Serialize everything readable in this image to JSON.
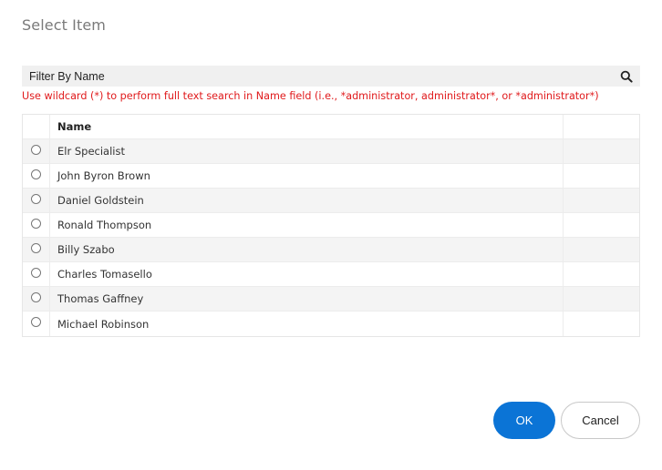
{
  "dialog": {
    "title": "Select Item"
  },
  "filter": {
    "placeholder": "Filter By Name",
    "value": "",
    "icon": "search-icon"
  },
  "hint": "Use wildcard (*) to perform full text search in Name field (i.e., *administrator, administrator*, or *administrator*)",
  "table": {
    "columns": [
      "",
      "Name",
      ""
    ],
    "rows": [
      {
        "name": "Elr Specialist",
        "selected": false
      },
      {
        "name": "John Byron Brown",
        "selected": false
      },
      {
        "name": "Daniel Goldstein",
        "selected": false
      },
      {
        "name": "Ronald Thompson",
        "selected": false
      },
      {
        "name": "Billy Szabo",
        "selected": false
      },
      {
        "name": "Charles Tomasello",
        "selected": false
      },
      {
        "name": "Thomas Gaffney",
        "selected": false
      },
      {
        "name": "Michael Robinson",
        "selected": false
      }
    ]
  },
  "buttons": {
    "ok": "OK",
    "cancel": "Cancel"
  },
  "colors": {
    "accent": "#0b74d6",
    "hint": "#e0191b"
  }
}
